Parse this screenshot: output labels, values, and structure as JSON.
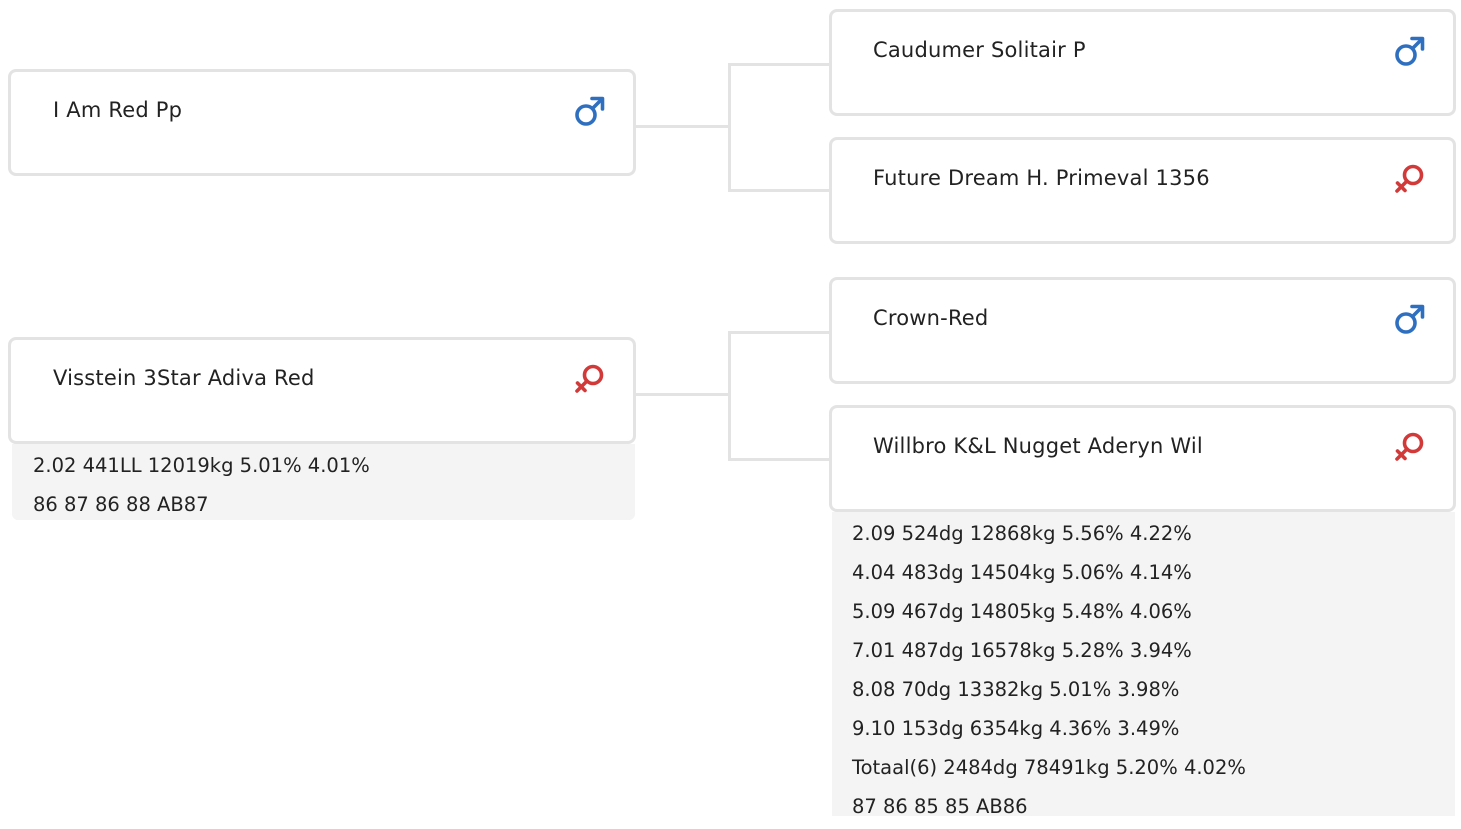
{
  "nodes": {
    "sire": {
      "name": "I Am Red Pp",
      "sex": "male"
    },
    "dam": {
      "name": "Visstein 3Star Adiva Red",
      "sex": "female",
      "stats": [
        "2.02 441LL 12019kg 5.01% 4.01%",
        "86 87 86 88 AB87"
      ]
    },
    "sire_sire": {
      "name": "Caudumer Solitair P",
      "sex": "male"
    },
    "sire_dam": {
      "name": "Future Dream H. Primeval 1356",
      "sex": "female"
    },
    "dam_sire": {
      "name": "Crown-Red",
      "sex": "male"
    },
    "dam_dam": {
      "name": "Willbro K&L Nugget Aderyn Wil",
      "sex": "female",
      "stats": [
        "2.09 524dg 12868kg 5.56% 4.22%",
        "4.04 483dg 14504kg 5.06% 4.14%",
        "5.09 467dg 14805kg 5.48% 4.06%",
        "7.01 487dg 16578kg 5.28% 3.94%",
        "8.08 70dg 13382kg 5.01% 3.98%",
        "9.10 153dg 6354kg 4.36% 3.49%",
        "Totaal(6) 2484dg 78491kg 5.20% 4.02%",
        "87 86 85 85 AB86"
      ]
    }
  },
  "colors": {
    "male": "#2f6fc0",
    "female": "#d23a3a",
    "border": "#e3e3e3",
    "stats_bg": "#f4f4f4"
  },
  "icons": {
    "male": "male-symbol-icon",
    "female": "female-symbol-icon"
  }
}
